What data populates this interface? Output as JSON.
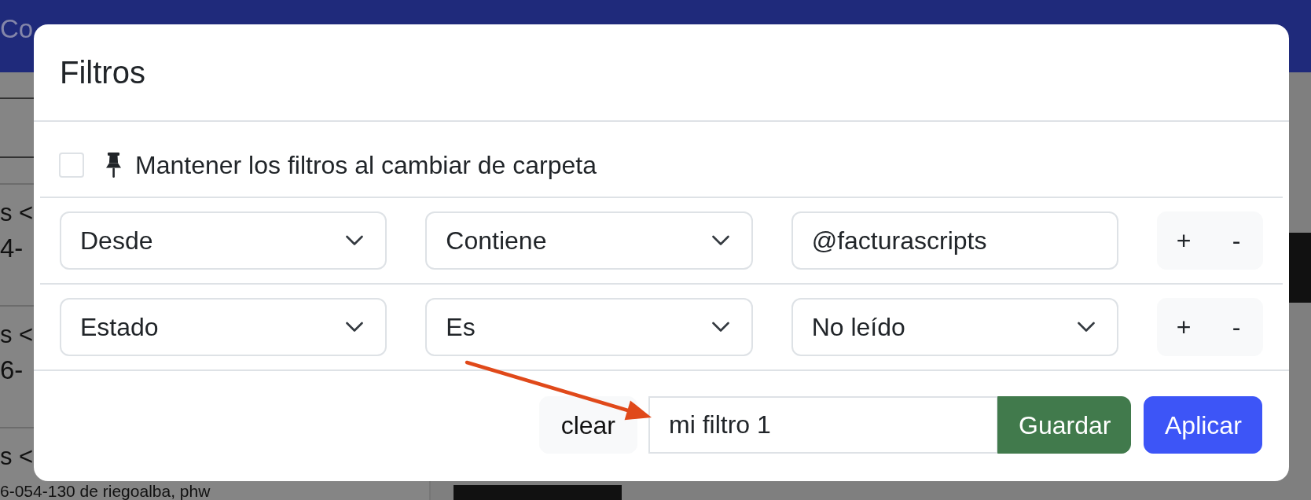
{
  "navbar": {
    "title": "Co"
  },
  "messages": [
    {
      "sender": "s <",
      "subject": "4-"
    },
    {
      "sender": "s <",
      "subject": "6-"
    },
    {
      "sender": "s <",
      "subject": "6-054-130 de riegoalba, phw"
    }
  ],
  "modal": {
    "title": "Filtros",
    "keep_filters": {
      "label": "Mantener los filtros al cambiar de carpeta",
      "checked": false
    },
    "filters": [
      {
        "field": "Desde",
        "operator": "Contiene",
        "kind": "text",
        "value": "@facturascripts",
        "add": "+",
        "remove": "-"
      },
      {
        "field": "Estado",
        "operator": "Es",
        "kind": "select",
        "value": "No leído",
        "add": "+",
        "remove": "-"
      }
    ],
    "footer": {
      "clear": "clear",
      "filter_name": "mi filtro 1",
      "save": "Guardar",
      "apply": "Aplicar"
    }
  }
}
